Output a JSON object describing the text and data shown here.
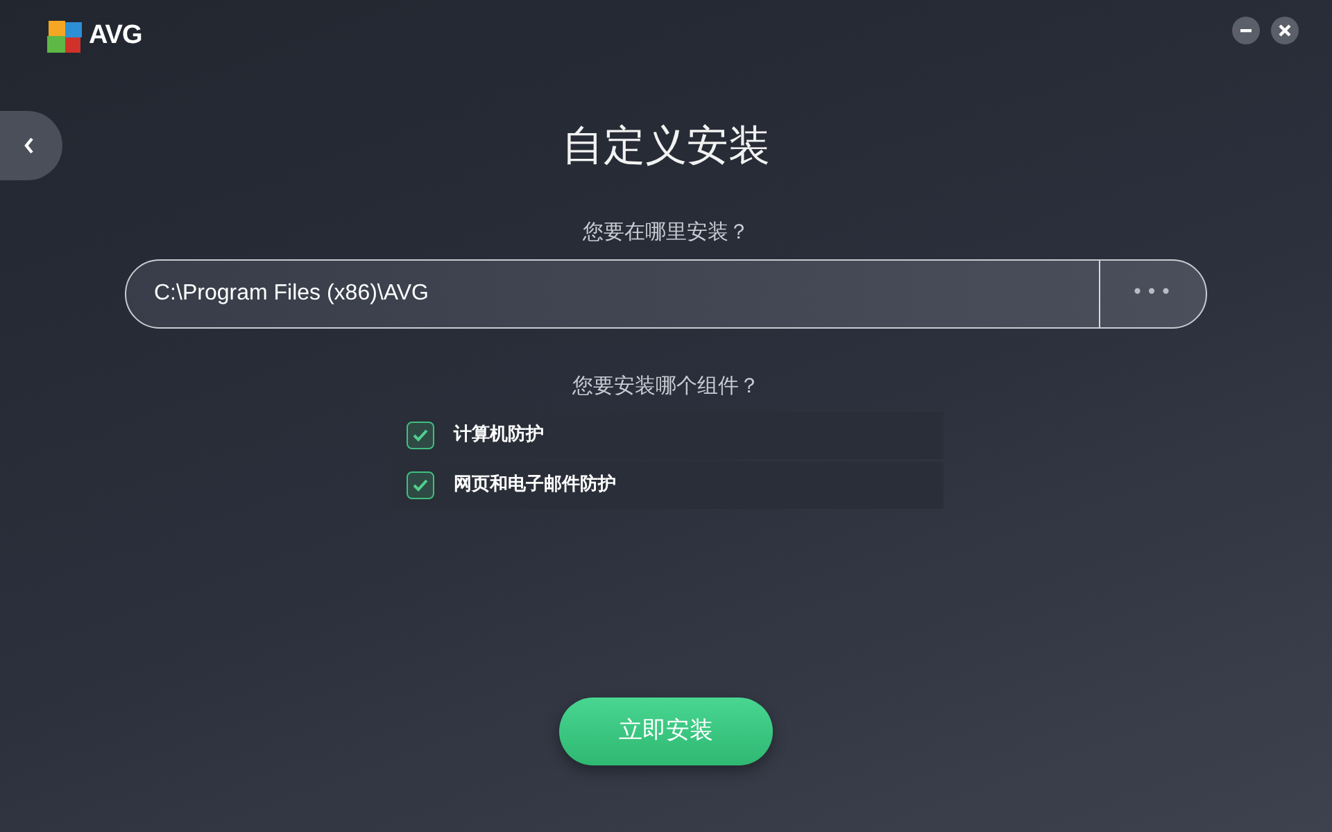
{
  "logo": {
    "text": "AVG"
  },
  "title": "自定义安装",
  "location": {
    "question": "您要在哪里安装？",
    "value": "C:\\Program Files (x86)\\AVG",
    "browse": "•••"
  },
  "components": {
    "question": "您要安装哪个组件？",
    "items": [
      {
        "label": "计算机防护",
        "checked": true
      },
      {
        "label": "网页和电子邮件防护",
        "checked": true
      }
    ]
  },
  "install_button": "立即安装"
}
